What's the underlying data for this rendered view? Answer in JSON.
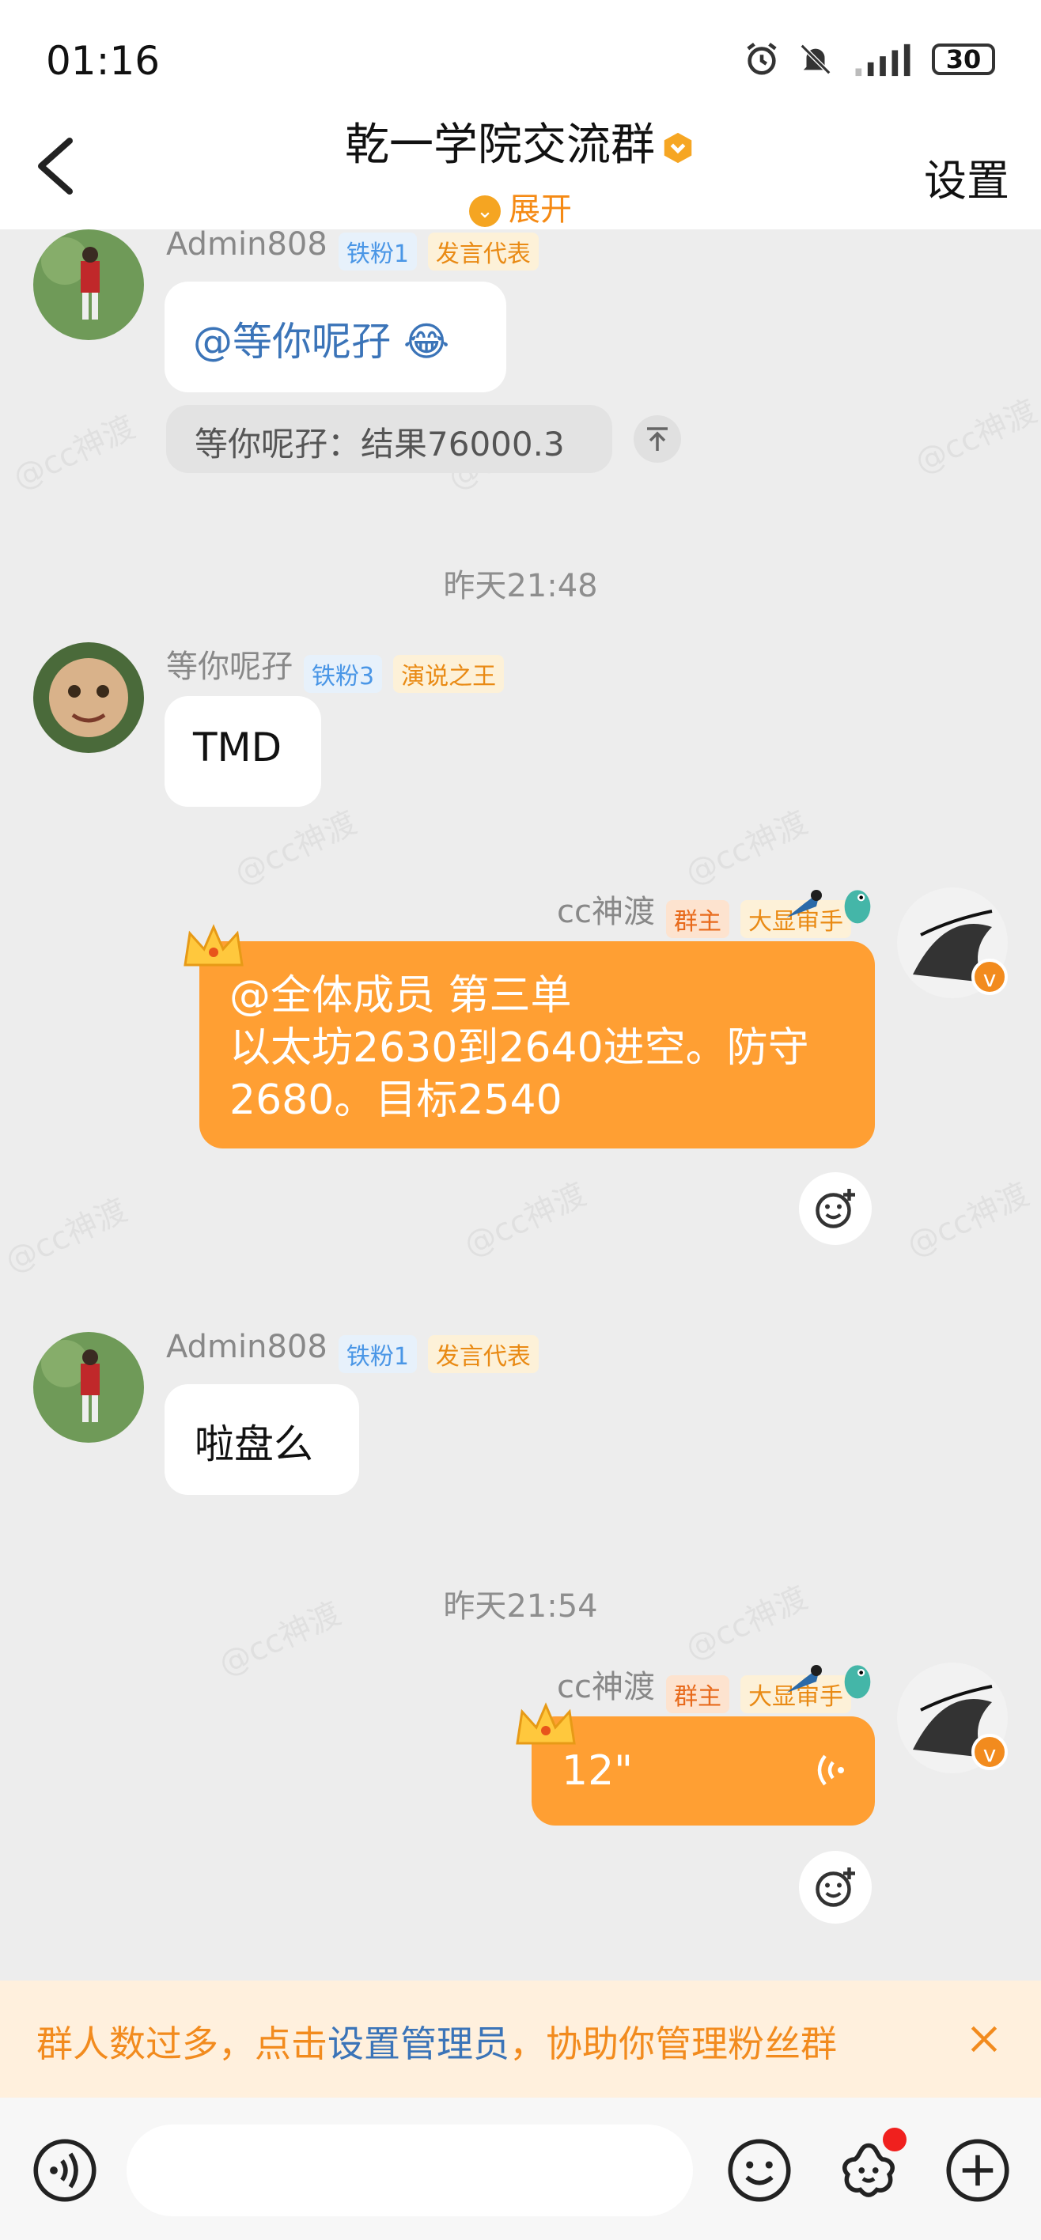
{
  "status_bar": {
    "time": "01:16",
    "battery": "30"
  },
  "header": {
    "title": "乾一学院交流群",
    "expand_label": "展开",
    "settings_label": "设置"
  },
  "messages": [
    {
      "sender": "Admin808",
      "fan_badge": "铁粉1",
      "role_badge": "发言代表",
      "text": "@等你呢孖 😂",
      "reply": "等你呢孖：结果76000.3"
    },
    {
      "timestamp": "昨天21:48"
    },
    {
      "sender": "等你呢孖",
      "fan_badge": "铁粉3",
      "role_badge": "演说之王",
      "text": "TMD"
    },
    {
      "sender": "cc神渡",
      "owner_badge": "群主",
      "role_badge": "大显审手",
      "text_lines": [
        "@全体成员 第三单",
        "以太坊2630到2640进空。防守",
        "2680。目标2540"
      ]
    },
    {
      "sender": "Admin808",
      "fan_badge": "铁粉1",
      "role_badge": "发言代表",
      "text": "啦盘么"
    },
    {
      "timestamp": "昨天21:54"
    },
    {
      "sender": "cc神渡",
      "owner_badge": "群主",
      "role_badge": "大显审手",
      "voice_duration": "12\""
    }
  ],
  "watermark": "@cc神渡",
  "banner": {
    "prefix": "群人数过多，点击",
    "link": "设置管理员",
    "suffix": "，协助你管理粉丝群"
  },
  "input": {
    "placeholder": ""
  },
  "colors": {
    "accent": "#ff9f33",
    "link": "#3b74b8",
    "banner_bg": "#fff0dd"
  }
}
